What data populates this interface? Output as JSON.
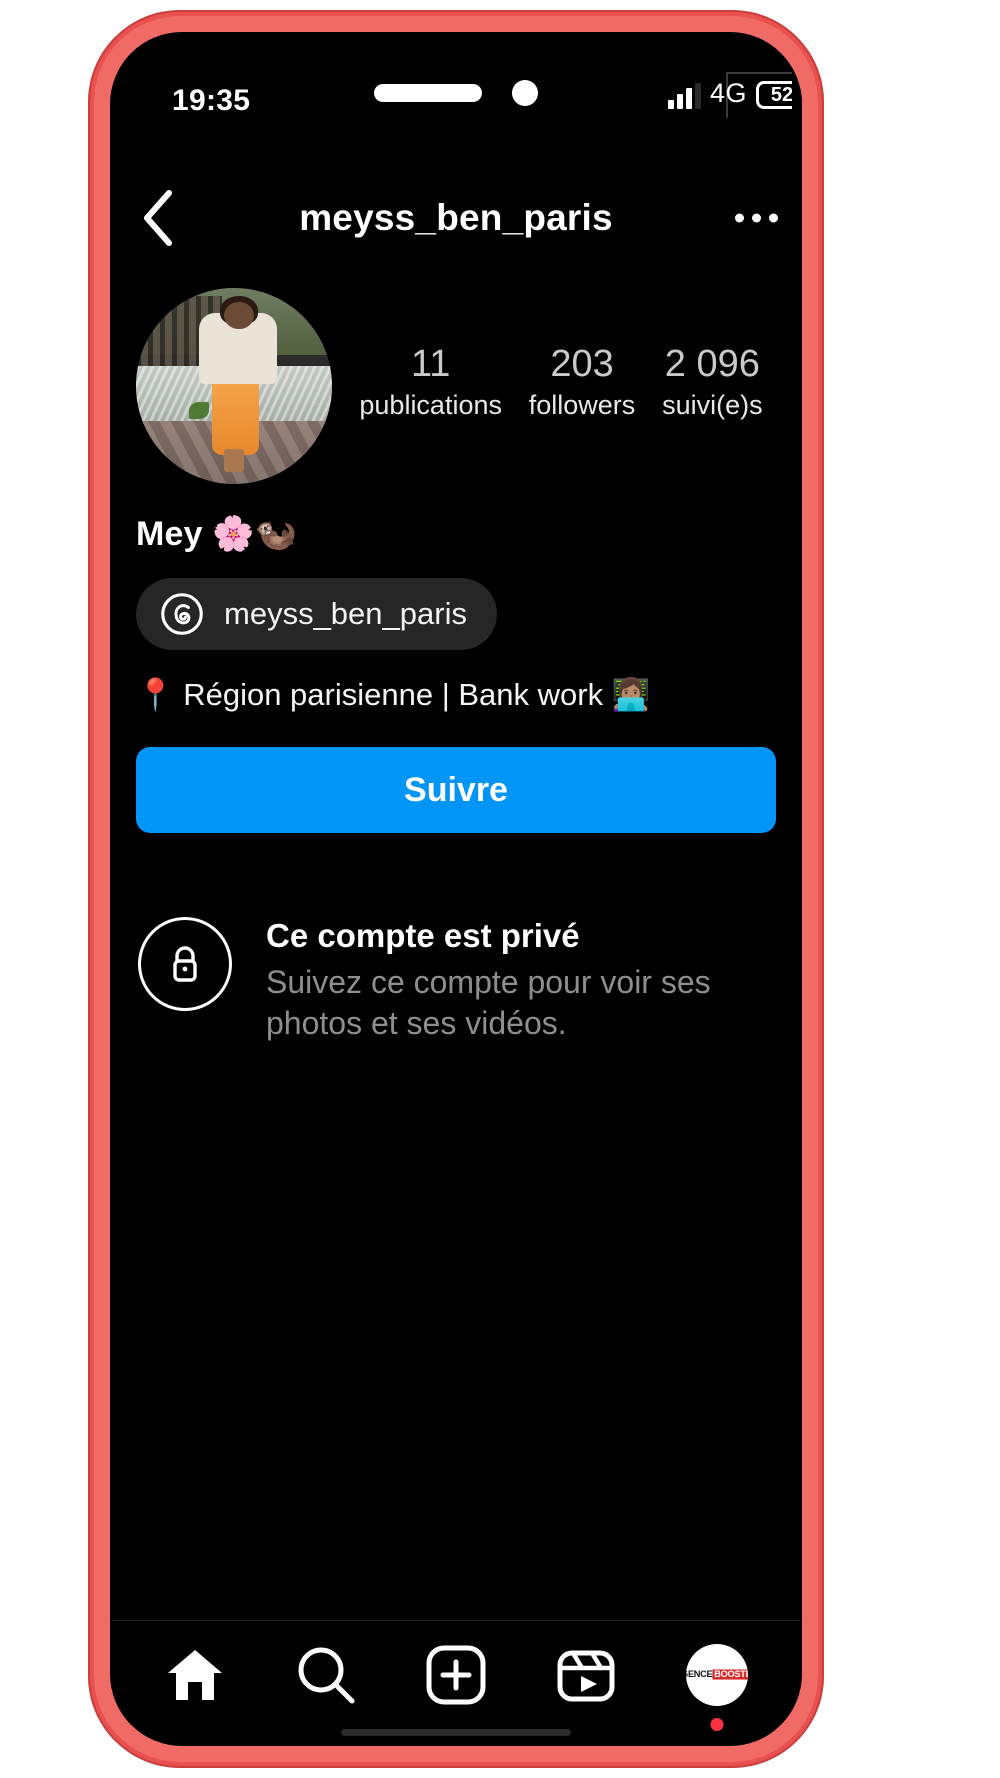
{
  "status_bar": {
    "time": "19:35",
    "network": "4G",
    "battery_level": "52",
    "signal_icon": "signal-bars-icon"
  },
  "header": {
    "back_icon": "chevron-left-icon",
    "username": "meyss_ben_paris",
    "more_icon": "more-options-icon"
  },
  "profile": {
    "avatar_name": "profile-avatar",
    "display_name": "Mey 🌸🦦",
    "threads_handle": "meyss_ben_paris",
    "threads_icon": "threads-icon",
    "bio": "📍 Région parisienne | Bank work 👩🏽‍💻",
    "stats": [
      {
        "value": "11",
        "label": "publications"
      },
      {
        "value": "203",
        "label": "followers"
      },
      {
        "value": "2 096",
        "label": "suivi(e)s"
      }
    ]
  },
  "actions": {
    "follow_label": "Suivre",
    "follow_color": "#0095f6"
  },
  "private_notice": {
    "lock_icon": "lock-icon",
    "title": "Ce compte est privé",
    "subtitle": "Suivez ce compte pour voir ses photos et ses vidéos."
  },
  "bottom_nav": [
    {
      "name": "home",
      "icon": "home-icon"
    },
    {
      "name": "search",
      "icon": "search-icon"
    },
    {
      "name": "create",
      "icon": "plus-square-icon"
    },
    {
      "name": "reels",
      "icon": "reels-icon"
    },
    {
      "name": "profile",
      "icon": "profile-avatar-icon",
      "avatar_text_left": "AGENCE",
      "avatar_text_right": "BOOSTER"
    }
  ],
  "device": {
    "frame_color": "#e8514f"
  }
}
